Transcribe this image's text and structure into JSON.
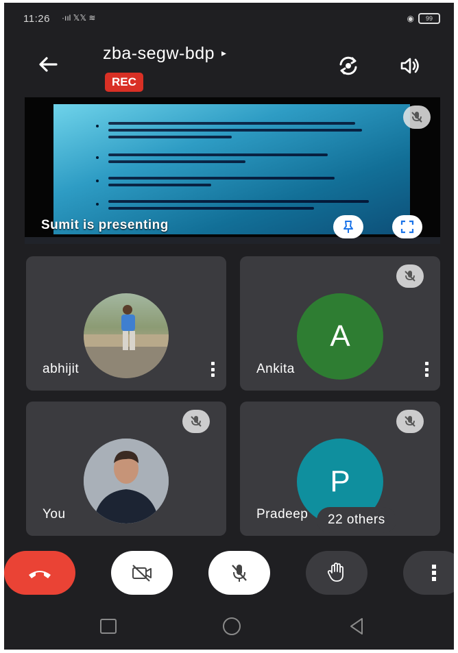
{
  "status_bar": {
    "time": "11:26",
    "signal": "·ııl 𝕏𝕏 ≋",
    "battery": "99"
  },
  "header": {
    "meeting_code": "zba-segw-bdp",
    "caret": "▸",
    "rec_label": "REC"
  },
  "presentation": {
    "label": "Sumit is presenting"
  },
  "participants": [
    {
      "name": "abhijit",
      "kind": "photo"
    },
    {
      "name": "Ankita",
      "initial": "A",
      "color": "#2e7d32"
    },
    {
      "name": "You",
      "kind": "photo"
    },
    {
      "name": "Pradeep",
      "initial": "P",
      "color": "#0f8f9e"
    }
  ],
  "others_label": "22 others",
  "colors": {
    "end_call": "#ea4335",
    "rec": "#d93025",
    "tile_bg": "#3b3b3f",
    "screen_bg": "#1f1f22"
  },
  "icons": [
    "back-arrow-icon",
    "switch-camera-icon",
    "speaker-icon",
    "pin-icon",
    "fullscreen-icon",
    "mic-off-icon",
    "end-call-icon",
    "camera-off-icon",
    "raise-hand-icon",
    "more-vert-icon",
    "nav-recents-icon",
    "nav-home-icon",
    "nav-back-icon"
  ]
}
